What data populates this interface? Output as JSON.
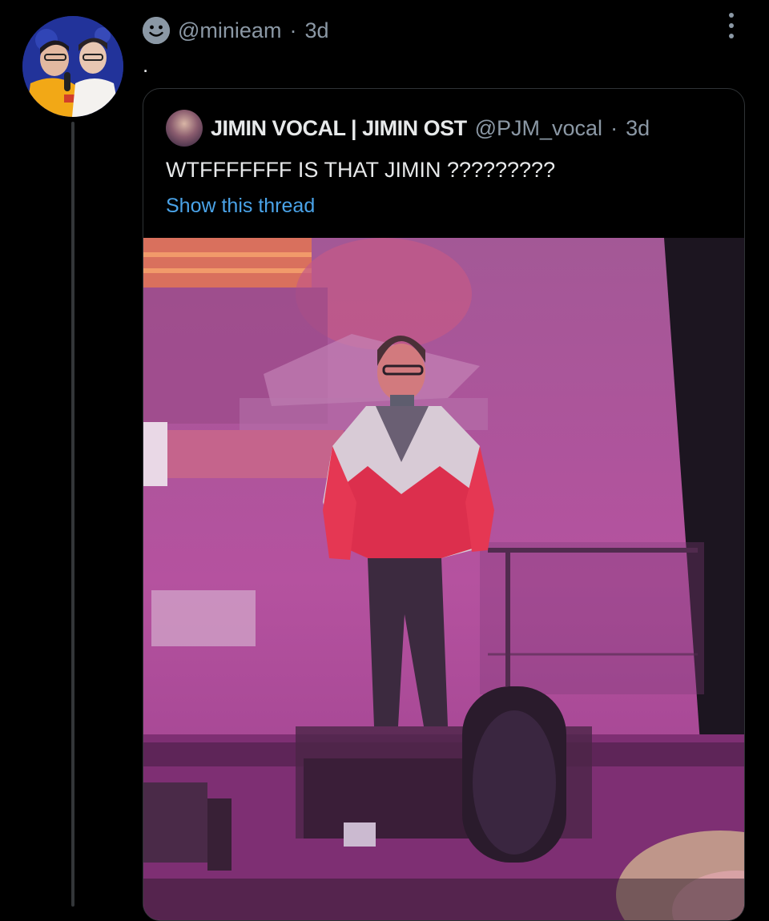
{
  "reply": {
    "handle": "@minieam",
    "time": "3d",
    "separator": "·",
    "text": "."
  },
  "quoted_tweet": {
    "display_name": "JIMIN VOCAL | JIMIN OST",
    "handle": "@PJM_vocal",
    "separator": "·",
    "time": "3d",
    "text": "WTFFFFFFF IS THAT JIMIN ?????????",
    "show_thread_label": "Show this thread"
  },
  "icons": {
    "reply_avatar": "profile-photo",
    "header_icon": "smiley-icon",
    "menu": "more-options-icon",
    "quoted_avatar": "profile-photo"
  },
  "colors": {
    "background": "#000000",
    "text": "#e7e9ea",
    "muted": "#8b98a5",
    "link": "#4aa3e8",
    "border": "#2f3336",
    "photo_tint": "#b04d97"
  }
}
